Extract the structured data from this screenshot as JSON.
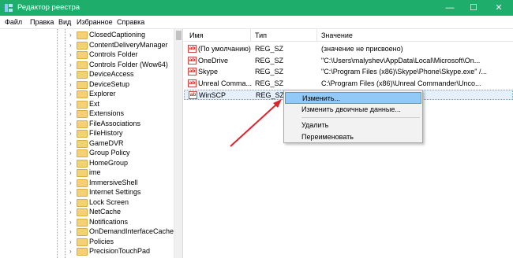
{
  "window": {
    "title": "Редактор реестра",
    "minimize": "—",
    "maximize": "☐",
    "close": "✕"
  },
  "menu": [
    "Файл",
    "Правка",
    "Вид",
    "Избранное",
    "Справка"
  ],
  "tree": {
    "items": [
      "ClosedCaptioning",
      "ContentDeliveryManager",
      "Controls Folder",
      "Controls Folder (Wow64)",
      "DeviceAccess",
      "DeviceSetup",
      "Explorer",
      "Ext",
      "Extensions",
      "FileAssociations",
      "FileHistory",
      "GameDVR",
      "Group Policy",
      "HomeGroup",
      "ime",
      "ImmersiveShell",
      "Internet Settings",
      "Lock Screen",
      "NetCache",
      "Notifications",
      "OnDemandInterfaceCache",
      "Policies",
      "PrecisionTouchPad"
    ]
  },
  "list": {
    "headers": {
      "name": "Имя",
      "type": "Тип",
      "value": "Значение"
    },
    "rows": [
      {
        "name": "(По умолчанию)",
        "type": "REG_SZ",
        "value": "(значение не присвоено)"
      },
      {
        "name": "OneDrive",
        "type": "REG_SZ",
        "value": "\"C:\\Users\\malyshev\\AppData\\Local\\Microsoft\\On..."
      },
      {
        "name": "Skype",
        "type": "REG_SZ",
        "value": "\"C:\\Program Files (x86)\\Skype\\Phone\\Skype.exe\" /..."
      },
      {
        "name": "Unreal Comma...",
        "type": "REG_SZ",
        "value": "C:\\Program Files (x86)\\Unreal Commander\\Unco..."
      },
      {
        "name": "WinSCP",
        "type": "REG_SZ",
        "value": ""
      }
    ]
  },
  "context_menu": {
    "items": [
      "Изменить...",
      "Изменить двоичные данные...",
      "Удалить",
      "Переименовать"
    ]
  },
  "colors": {
    "titlebar": "#1fad6b",
    "arrow": "#d9262c",
    "highlight": "#91c9f7"
  }
}
